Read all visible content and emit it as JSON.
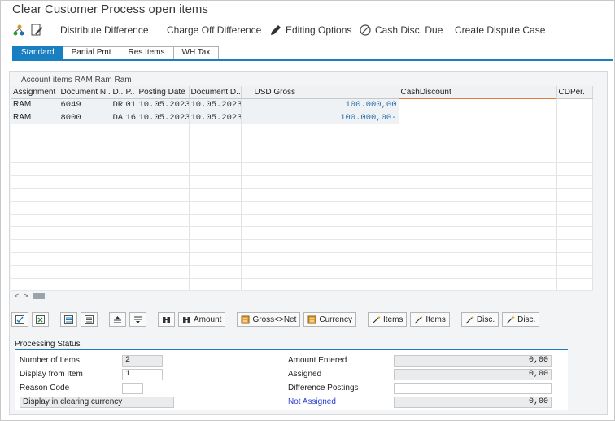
{
  "window": {
    "title": "Clear Customer Process open items"
  },
  "toolbar": {
    "distribute": "Distribute Difference",
    "chargeoff": "Charge Off Difference",
    "editing": "Editing Options",
    "cashdisc": "Cash Disc. Due",
    "dispute": "Create Dispute Case"
  },
  "tabs": [
    "Standard",
    "Partial Pmt",
    "Res.Items",
    "WH Tax"
  ],
  "panel": {
    "account_title": "Account items RAM Ram Ram"
  },
  "grid": {
    "columns": [
      "Assignment",
      "Document N...",
      "D..",
      "P..",
      "Posting Date",
      "Document D...",
      "USD Gross",
      "CashDiscount",
      "CDPer."
    ],
    "rows": [
      [
        "RAM",
        "6049",
        "DR",
        "01",
        "10.05.2023",
        "10.05.2023",
        "100.000,00",
        "",
        ""
      ],
      [
        "RAM",
        "8000",
        "DA",
        "16",
        "10.05.2023",
        "10.05.2023",
        "100.000,00-",
        "",
        ""
      ]
    ]
  },
  "scroll": {
    "left": "<",
    "right": ">"
  },
  "buttons": {
    "amount": "Amount",
    "gross_net": "Gross<>Net",
    "currency": "Currency",
    "items1": "Items",
    "items2": "Items",
    "disc1": "Disc.",
    "disc2": "Disc."
  },
  "status": {
    "header": "Processing Status",
    "num_items_label": "Number of Items",
    "num_items_value": "2",
    "display_from_label": "Display from Item",
    "display_from_value": "1",
    "reason_label": "Reason Code",
    "reason_value": "",
    "display_clearing": "Display in clearing currency",
    "amount_entered_label": "Amount Entered",
    "amount_entered_value": "0,00",
    "assigned_label": "Assigned",
    "assigned_value": "0,00",
    "diff_postings_label": "Difference Postings",
    "diff_postings_value": "",
    "not_assigned_label": "Not Assigned",
    "not_assigned_value": "0,00"
  },
  "colors": {
    "accent": "#1a7fc1",
    "amount": "#2b6fad",
    "link": "#2a3bd1"
  }
}
